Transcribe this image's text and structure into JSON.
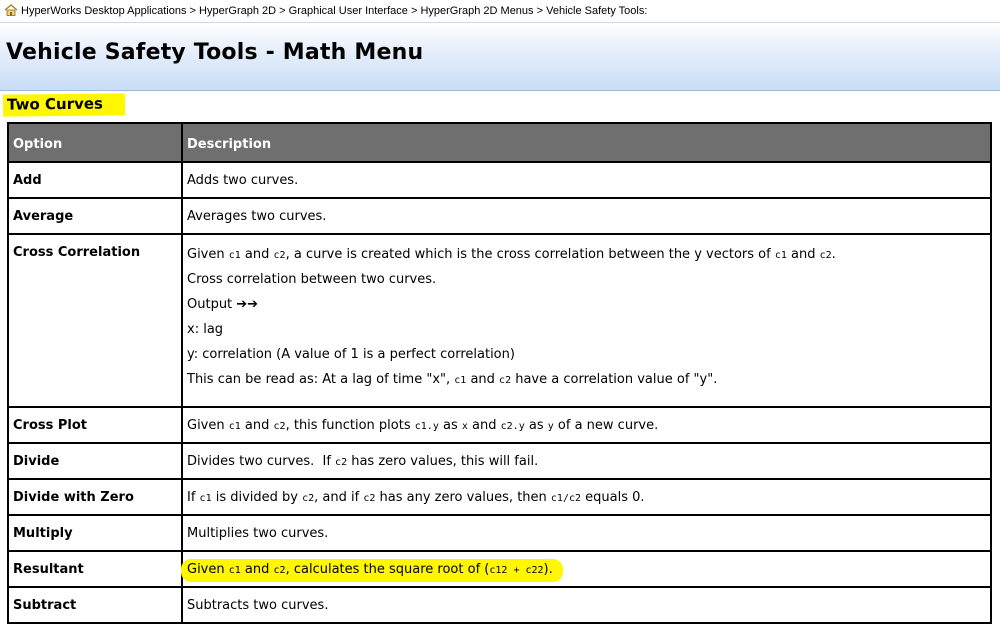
{
  "breadcrumb": {
    "items": [
      "HyperWorks Desktop Applications",
      "HyperGraph 2D",
      "Graphical User Interface",
      "HyperGraph 2D Menus",
      "Vehicle Safety Tools:"
    ],
    "separator": ">",
    "home_icon": "home-icon"
  },
  "page": {
    "title": "Vehicle Safety Tools - Math Menu",
    "section_heading": "Two Curves"
  },
  "colors": {
    "highlight": "#fff700",
    "header_bg": "#6f6f6f",
    "banner_bottom": "#c9ddf6"
  },
  "table": {
    "headers": {
      "option": "Option",
      "description": "Description"
    },
    "rows": {
      "add": {
        "option": "Add",
        "desc": "Adds two curves."
      },
      "average": {
        "option": "Average",
        "desc": "Averages two curves."
      },
      "cross_correlation": {
        "option": "Cross Correlation",
        "line1": {
          "a": "Given ",
          "c1": "c1",
          "b": " and ",
          "c2": "c2",
          "c": ", a curve is created which is the cross correlation between the y vectors of ",
          "c1b": "c1",
          "d": " and ",
          "c2b": "c2",
          "e": "."
        },
        "line2": "Cross correlation between two curves.",
        "line3": "Output ➔➔",
        "line4": "x: lag",
        "line5": "y: correlation (A value of 1 is a perfect correlation)",
        "line6": {
          "a": "This can be read as: At a lag of time \"x\", ",
          "c1": "c1",
          "b": " and ",
          "c2": "c2",
          "c": " have a correlation value of \"y\"."
        }
      },
      "cross_plot": {
        "option": "Cross Plot",
        "desc": {
          "a": "Given ",
          "c1": "c1",
          "b": " and ",
          "c2": "c2",
          "c": ", this function plots ",
          "c1y": "c1.y",
          "d": " as ",
          "x": "x",
          "e": " and ",
          "c2y": "c2.y",
          "f": " as ",
          "y": "y",
          "g": " of a new curve."
        }
      },
      "divide": {
        "option": "Divide",
        "desc": {
          "a": "Divides two curves.  If ",
          "c2": "c2",
          "b": " has zero values, this will fail."
        }
      },
      "divide_with_zero": {
        "option": "Divide with Zero",
        "desc": {
          "a": "If ",
          "c1": "c1",
          "b": " is divided by ",
          "c2": "c2",
          "c": ", and if ",
          "c2b": "c2",
          "d": " has any zero values, then ",
          "expr": "c1/c2",
          "e": " equals 0."
        }
      },
      "multiply": {
        "option": "Multiply",
        "desc": "Multiplies two curves."
      },
      "resultant": {
        "option": "Resultant",
        "desc": {
          "a": "Given ",
          "c1": "c1",
          "b": " and ",
          "c2": "c2",
          "c": ", calculates the square root of (",
          "expr1": "c12",
          "plus": " + ",
          "expr2": "c22",
          "d": ")."
        }
      },
      "subtract": {
        "option": "Subtract",
        "desc": "Subtracts two curves."
      }
    }
  }
}
